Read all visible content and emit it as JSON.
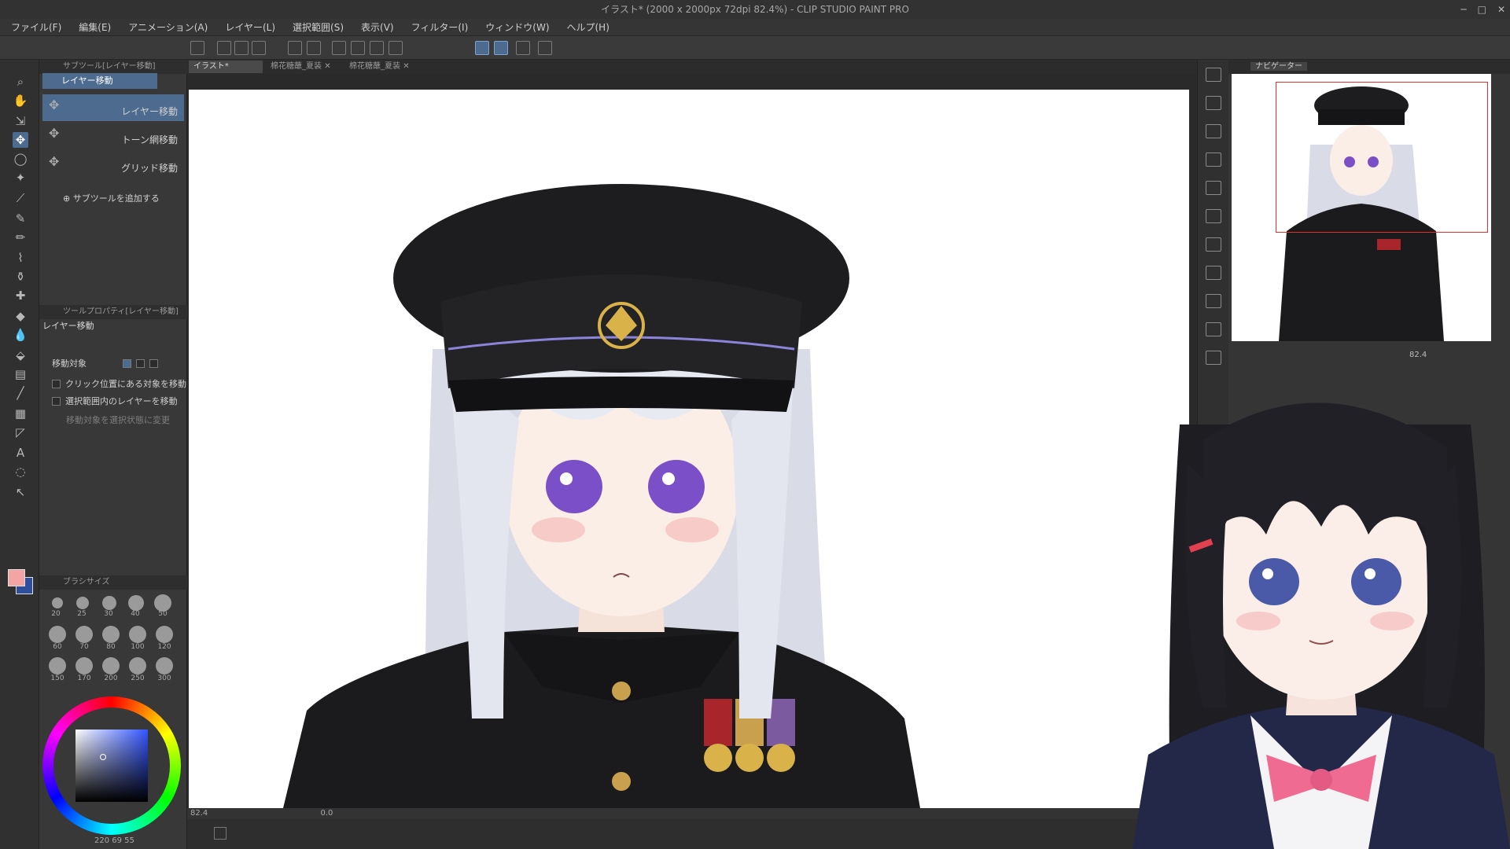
{
  "window": {
    "title": "イラスト* (2000 x 2000px 72dpi 82.4%)  - CLIP STUDIO PAINT PRO"
  },
  "menu": [
    "ファイル(F)",
    "編集(E)",
    "アニメーション(A)",
    "レイヤー(L)",
    "選択範囲(S)",
    "表示(V)",
    "フィルター(I)",
    "ウィンドウ(W)",
    "ヘルプ(H)"
  ],
  "subtool_panel": {
    "tab": "サブツール[レイヤー移動]",
    "header": "レイヤー移動",
    "items": [
      "レイヤー移動",
      "トーン網移動",
      "グリッド移動"
    ],
    "add_label": "サブツールを追加する"
  },
  "tool_property": {
    "tab": "ツールプロパティ[レイヤー移動]",
    "title": "レイヤー移動",
    "move_target_label": "移動対象",
    "options": [
      "クリック位置にある対象を移動",
      "選択範囲内のレイヤーを移動"
    ],
    "disabled_option": "移動対象を選択状態に変更"
  },
  "brush_size": {
    "tab": "ブラシサイズ",
    "sizes": [
      "20",
      "25",
      "30",
      "40",
      "50",
      "60",
      "70",
      "80",
      "100",
      "120",
      "150",
      "170",
      "200",
      "250",
      "300"
    ]
  },
  "color": {
    "main": "#f3a5a5",
    "sub": "#2f4f9c",
    "readout": "220  69  55"
  },
  "document_tabs": [
    "イラスト*",
    "棉花糖蘸_夏装",
    "棉花糖蘸_夏装"
  ],
  "status": {
    "zoom": "82.4",
    "angle": "0.0"
  },
  "navigator": {
    "tab": "ナビゲーター",
    "zoom": "82.4"
  },
  "colors": {
    "accent": "#4c6b8f",
    "panel_bg": "#383838",
    "canvas_bg": "#ffffff",
    "nav_frame": "#e03030"
  }
}
